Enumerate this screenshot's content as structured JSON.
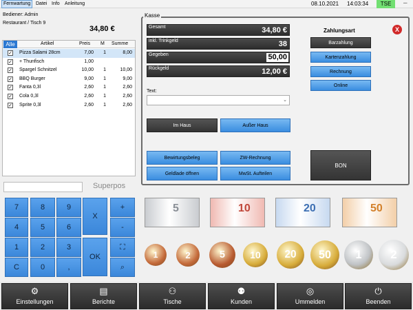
{
  "menu": {
    "items": [
      "Fernwartung",
      "Datei",
      "Info",
      "Anleitung"
    ],
    "date": "08.10.2021",
    "time": "14:03:34",
    "tse": "TSE",
    "minimize": "–"
  },
  "order": {
    "bediener": "Bediener:  Admin",
    "table": "Restaurant / Tisch 9",
    "total": "34,80 €"
  },
  "table": {
    "headers": {
      "alle": "Alle",
      "artikel": "Artikel",
      "preis": "Preis",
      "m": "M",
      "summe": "Summe"
    },
    "rows": [
      {
        "name": "Pizza Salami 28cm",
        "preis": "7,00",
        "m": "1",
        "summe": "8,00"
      },
      {
        "name": "+ Thunfisch",
        "preis": "1,00",
        "m": "",
        "summe": ""
      },
      {
        "name": "Spargel Schnitzel",
        "preis": "10,00",
        "m": "1",
        "summe": "10,00"
      },
      {
        "name": "BBQ Burger",
        "preis": "9,00",
        "m": "1",
        "summe": "9,00"
      },
      {
        "name": "Fanta 0,3l",
        "preis": "2,60",
        "m": "1",
        "summe": "2,60"
      },
      {
        "name": "Cola 0,3l",
        "preis": "2,60",
        "m": "1",
        "summe": "2,60"
      },
      {
        "name": "Sprite 0,3l",
        "preis": "2,60",
        "m": "1",
        "summe": "2,60"
      }
    ]
  },
  "numpad": {
    "superpos": "Superpos",
    "keys": [
      "7",
      "8",
      "9",
      "X",
      "+",
      "4",
      "5",
      "6",
      "-",
      "1",
      "2",
      "3",
      "OK",
      "C",
      "0",
      ","
    ]
  },
  "kasse": {
    "title": "Kasse",
    "gesamt_label": "Gesamt",
    "gesamt_value": "34,80 €",
    "trinkgeld_label": "inkl. Trinkgeld",
    "trinkgeld_value": "38",
    "gegeben_label": "Gegeben",
    "gegeben_value": "50,00",
    "rueckgeld_label": "Rückgeld",
    "rueckgeld_value": "12,00 €",
    "text_label": "Text:",
    "im_haus": "Im Haus",
    "ausser_haus": "Außer Haus",
    "bewirtungsbeleg": "Bewirtungsbeleg",
    "zw_rechnung": "ZW-Rechnung",
    "geldlade": "Geldlade öffnen",
    "mwst": "MwSt. Aufteilen",
    "zahlungsart": "Zahlungsart",
    "barzahlung": "Barzahlung",
    "kartenzahlung": "Kartenzahlung",
    "rechnung": "Rechnung",
    "online": "Online",
    "bon": "BON",
    "close": "X"
  },
  "money": {
    "notes": [
      "5",
      "10",
      "20",
      "50"
    ],
    "coins": [
      "1",
      "2",
      "5",
      "10",
      "20",
      "50",
      "1",
      "2"
    ]
  },
  "bottom": {
    "einstellungen": "Einstellungen",
    "berichte": "Berichte",
    "tische": "Tische",
    "kunden": "Kunden",
    "ummelden": "Ummelden",
    "beenden": "Beenden"
  },
  "colors": {
    "accent": "#3a8de0",
    "tse": "#72df72",
    "close": "#d12a2a",
    "dark": "#2d2d2d"
  }
}
